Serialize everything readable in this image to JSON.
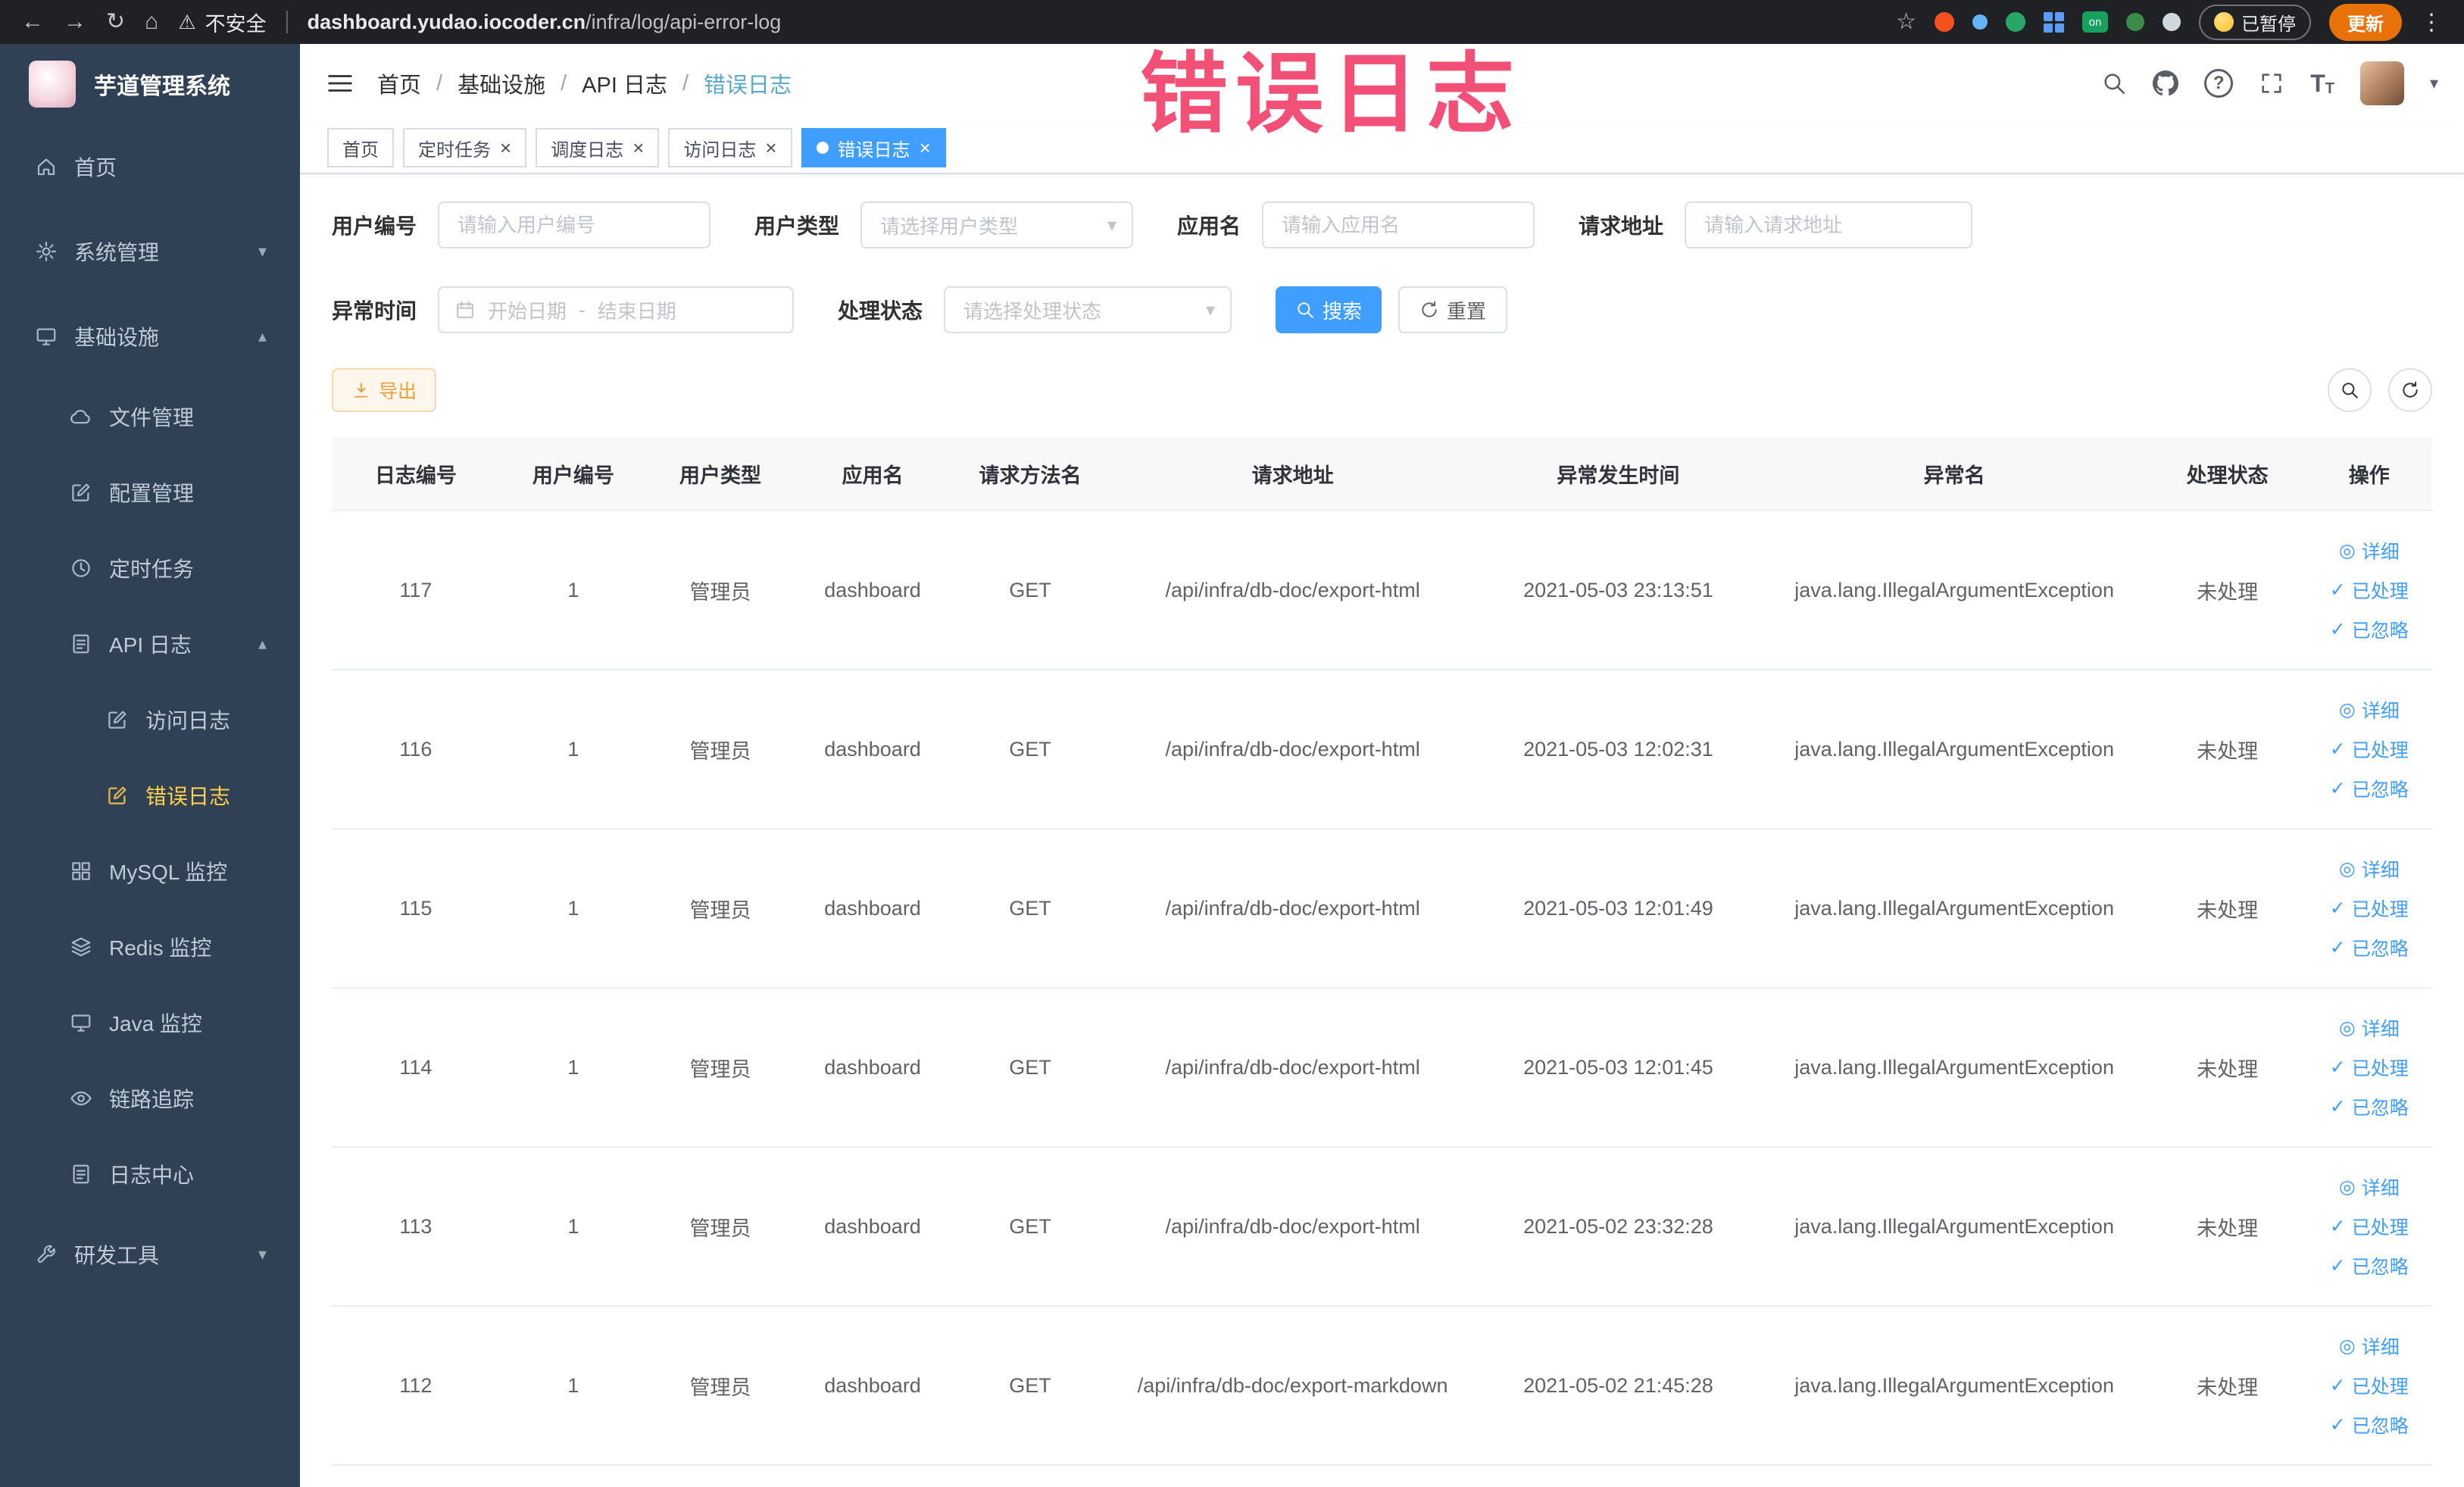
{
  "colors": {
    "accent_blue": "#409eff",
    "menu_active_yellow": "#ffd04b",
    "sidebar_bg": "#304156",
    "warning_orange": "#e6a23c",
    "watermark_red": "#f2436c",
    "update_button_orange": "#e8710a"
  },
  "browser": {
    "security_label": "不安全",
    "url_host": "dashboard.yudao.iocoder.cn",
    "url_path": "/infra/log/api-error-log",
    "extension_on_badge": "on",
    "paused_badge": "已暂停",
    "update_button": "更新"
  },
  "icons": {
    "back": "←",
    "forward": "→",
    "reload": "↻",
    "home": "⌂",
    "warning": "⚠",
    "star": "☆",
    "kebab": "⋮",
    "caret_down": "▾",
    "chevron_up": "▴",
    "chevron_down": "▾",
    "close": "×",
    "detail_bullseye": "◎",
    "check": "✓",
    "range_separator": "-",
    "question": "?",
    "breadcrumb_sep": "/",
    "font_size_large": "T",
    "font_size_small": "T"
  },
  "sidebar": {
    "logo_title": "芋道管理系统",
    "items": [
      {
        "label": "首页",
        "level": 1
      },
      {
        "label": "系统管理",
        "level": 1,
        "chevron": "down"
      },
      {
        "label": "基础设施",
        "level": 1,
        "chevron": "up"
      },
      {
        "label": "文件管理",
        "level": 2
      },
      {
        "label": "配置管理",
        "level": 2
      },
      {
        "label": "定时任务",
        "level": 2
      },
      {
        "label": "API 日志",
        "level": 2,
        "chevron": "up"
      },
      {
        "label": "访问日志",
        "level": 3
      },
      {
        "label": "错误日志",
        "level": 3,
        "active": true
      },
      {
        "label": "MySQL 监控",
        "level": 2
      },
      {
        "label": "Redis 监控",
        "level": 2
      },
      {
        "label": "Java 监控",
        "level": 2
      },
      {
        "label": "链路追踪",
        "level": 2
      },
      {
        "label": "日志中心",
        "level": 2
      },
      {
        "label": "研发工具",
        "level": 1,
        "chevron": "down"
      }
    ]
  },
  "header": {
    "breadcrumb": [
      "首页",
      "基础设施",
      "API 日志",
      "错误日志"
    ]
  },
  "tabs": [
    {
      "label": "首页"
    },
    {
      "label": "定时任务"
    },
    {
      "label": "调度日志"
    },
    {
      "label": "访问日志"
    },
    {
      "label": "错误日志",
      "active": true
    }
  ],
  "watermark": "错误日志",
  "filters": {
    "user_id_label": "用户编号",
    "user_id_placeholder": "请输入用户编号",
    "user_type_label": "用户类型",
    "user_type_placeholder": "请选择用户类型",
    "app_name_label": "应用名",
    "app_name_placeholder": "请输入应用名",
    "request_url_label": "请求地址",
    "request_url_placeholder": "请输入请求地址",
    "exception_time_label": "异常时间",
    "date_start_placeholder": "开始日期",
    "date_end_placeholder": "结束日期",
    "process_status_label": "处理状态",
    "process_status_placeholder": "请选择处理状态",
    "search_button": "搜索",
    "reset_button": "重置"
  },
  "toolbar": {
    "export_button": "导出"
  },
  "table": {
    "columns": [
      "日志编号",
      "用户编号",
      "用户类型",
      "应用名",
      "请求方法名",
      "请求地址",
      "异常发生时间",
      "异常名",
      "处理状态",
      "操作"
    ],
    "action_labels": {
      "detail": "详细",
      "processed": "已处理",
      "ignored": "已忽略"
    },
    "rows": [
      {
        "log_id": "117",
        "user_id": "1",
        "user_type": "管理员",
        "app_name": "dashboard",
        "method": "GET",
        "url": "/api/infra/db-doc/export-html",
        "time": "2021-05-03 23:13:51",
        "exception": "java.lang.IllegalArgumentException",
        "status": "未处理"
      },
      {
        "log_id": "116",
        "user_id": "1",
        "user_type": "管理员",
        "app_name": "dashboard",
        "method": "GET",
        "url": "/api/infra/db-doc/export-html",
        "time": "2021-05-03 12:02:31",
        "exception": "java.lang.IllegalArgumentException",
        "status": "未处理"
      },
      {
        "log_id": "115",
        "user_id": "1",
        "user_type": "管理员",
        "app_name": "dashboard",
        "method": "GET",
        "url": "/api/infra/db-doc/export-html",
        "time": "2021-05-03 12:01:49",
        "exception": "java.lang.IllegalArgumentException",
        "status": "未处理"
      },
      {
        "log_id": "114",
        "user_id": "1",
        "user_type": "管理员",
        "app_name": "dashboard",
        "method": "GET",
        "url": "/api/infra/db-doc/export-html",
        "time": "2021-05-03 12:01:45",
        "exception": "java.lang.IllegalArgumentException",
        "status": "未处理"
      },
      {
        "log_id": "113",
        "user_id": "1",
        "user_type": "管理员",
        "app_name": "dashboard",
        "method": "GET",
        "url": "/api/infra/db-doc/export-html",
        "time": "2021-05-02 23:32:28",
        "exception": "java.lang.IllegalArgumentException",
        "status": "未处理"
      },
      {
        "log_id": "112",
        "user_id": "1",
        "user_type": "管理员",
        "app_name": "dashboard",
        "method": "GET",
        "url": "/api/infra/db-doc/export-markdown",
        "time": "2021-05-02 21:45:28",
        "exception": "java.lang.IllegalArgumentException",
        "status": "未处理"
      }
    ]
  }
}
